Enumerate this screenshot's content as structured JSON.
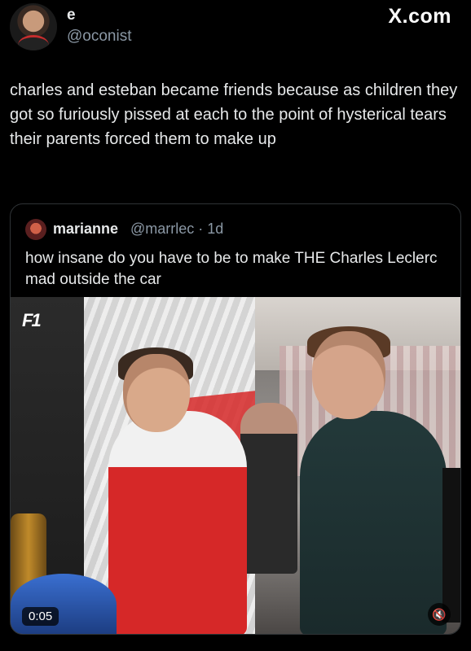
{
  "author": {
    "display_name": "e",
    "handle": "@oconist"
  },
  "brand": "X.com",
  "tweet": {
    "text": "charles and esteban became friends because as children they got so furiously pissed at each to the point of hysterical tears their parents forced them to make up"
  },
  "quoted_tweet": {
    "display_name": "marianne",
    "meta": "@marrlec · 1d",
    "text": "how insane do you have to be to make THE Charles Leclerc mad outside the car",
    "video": {
      "duration_label": "0:05",
      "logo_text": "F1",
      "mute_icon": "speaker-muted-icon"
    }
  }
}
